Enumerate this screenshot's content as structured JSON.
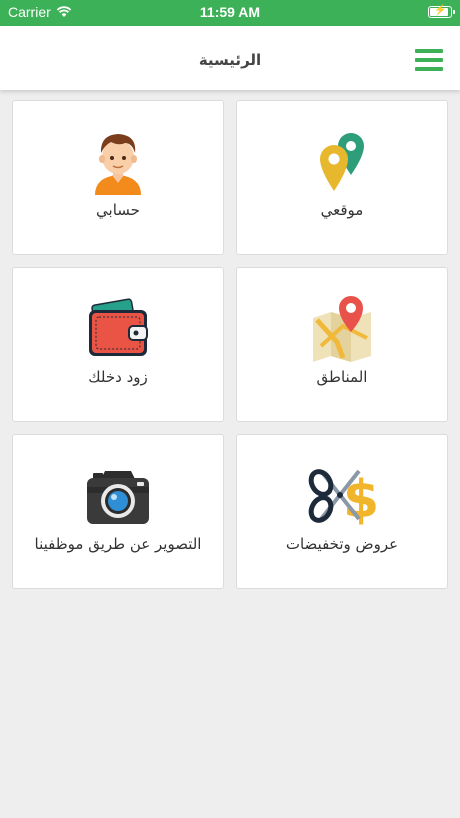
{
  "status_bar": {
    "carrier": "Carrier",
    "time": "11:59 AM"
  },
  "nav": {
    "title": "الرئيسية",
    "menu_icon": "hamburger-menu-icon",
    "accent": "#3db157"
  },
  "tiles": [
    {
      "label": "موقعي",
      "icon": "location-pins-icon"
    },
    {
      "label": "حسابي",
      "icon": "user-avatar-icon"
    },
    {
      "label": "المناطق",
      "icon": "map-icon"
    },
    {
      "label": "زود دخلك",
      "icon": "wallet-icon"
    },
    {
      "label": "عروض وتخفيضات",
      "icon": "discount-scissors-icon"
    },
    {
      "label": "التصوير عن طريق موظفينا",
      "icon": "camera-icon"
    }
  ]
}
